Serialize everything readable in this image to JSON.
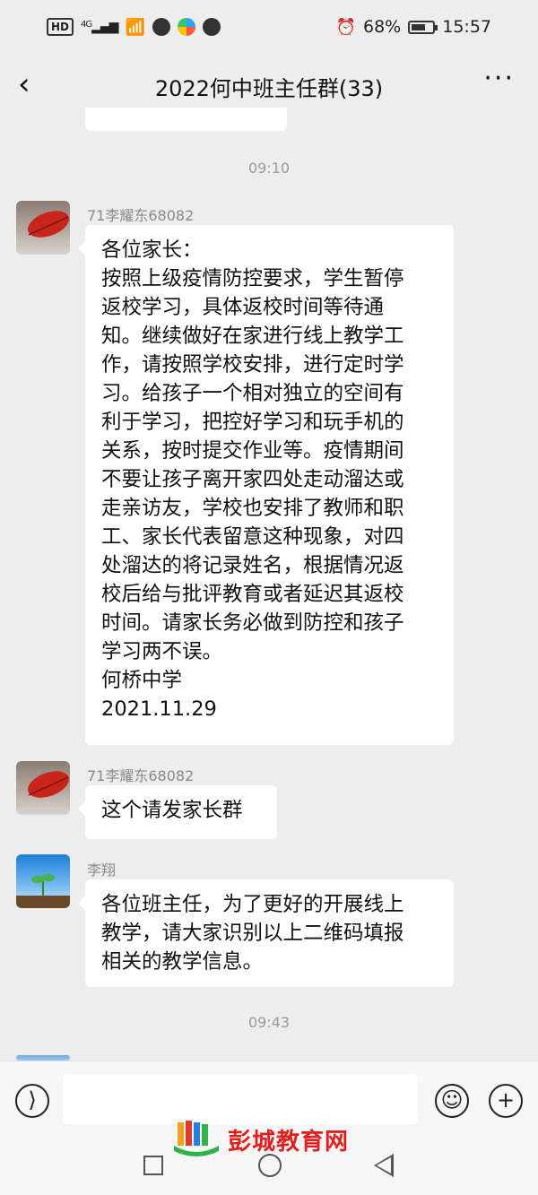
{
  "status_bar": {
    "left_label": "HD",
    "signal": "4G",
    "battery": "68%",
    "battery_level": 0.68,
    "time": "15:57"
  },
  "header": {
    "title": "2022何中班主任群(33)",
    "back_icon": "chevron-left-icon",
    "more_icon": "more-dots-icon"
  },
  "chat": {
    "timestamps": [
      "09:10",
      "09:43"
    ],
    "messages": [
      {
        "sender": "71李耀东68082",
        "avatar": "leaf-avatar",
        "lines": [
          "各位家长：",
          "按照上级疫情防控要求，学生暂停",
          "返校学习，具体返校时间等待通",
          "知。继续做好在家进行线上教学工",
          "作，请按照学校安排，进行定时学",
          "习。给孩子一个相对独立的空间有",
          "利于学习，把控好学习和玩手机的",
          "关系，按时提交作业等。疫情期间",
          "不要让孩子离开家四处走动溜达或",
          "走亲访友，学校也安排了教师和职",
          "工、家长代表留意这种现象，对四",
          "处溜达的将记录姓名，根据情况返",
          "校后给与批评教育或者延迟其返校",
          "时间。请家长务必做到防控和孩子",
          "学习两不误。",
          "何桥中学",
          "2021.11.29"
        ]
      },
      {
        "sender": "71李耀东68082",
        "avatar": "leaf-avatar",
        "lines": [
          "这个请发家长群"
        ]
      },
      {
        "sender": "李翔",
        "avatar": "sprout-avatar",
        "lines": [
          "各位班主任，为了更好的开展线上",
          "教学，请大家识别以上二维码填报",
          "相关的教学信息。"
        ]
      }
    ]
  },
  "input_bar": {
    "voice_icon": "voice-icon",
    "emoji_icon": "emoji-icon",
    "plus_icon": "plus-icon"
  },
  "watermark": {
    "text": "彭城教育网"
  },
  "nav_bar": {
    "icons": [
      "recent-apps-icon",
      "home-icon",
      "back-icon"
    ]
  }
}
